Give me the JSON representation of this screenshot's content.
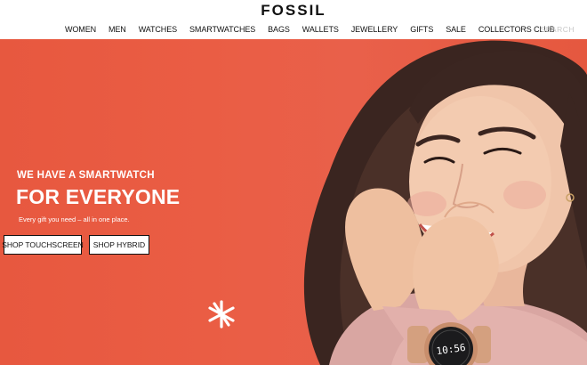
{
  "header": {
    "logo": "FOSSIL",
    "nav": [
      "WOMEN",
      "MEN",
      "WATCHES",
      "SMARTWATCHES",
      "BAGS",
      "WALLETS",
      "JEWELLERY",
      "GIFTS",
      "SALE",
      "COLLECTORS CLUB"
    ],
    "search_placeholder": "SEARCH"
  },
  "hero": {
    "eyebrow": "WE HAVE A SMARTWATCH",
    "headline": "FOR EVERYONE",
    "subtext": "Every gift you need – all in one place.",
    "buttons": {
      "touchscreen": "SHOP TOUCHSCREEN",
      "hybrid": "SHOP HYBRID"
    },
    "watch_time": "10:56",
    "colors": {
      "background": "#e9593f",
      "text": "#ffffff",
      "button_bg": "#ffffff",
      "button_border": "#111111"
    }
  }
}
